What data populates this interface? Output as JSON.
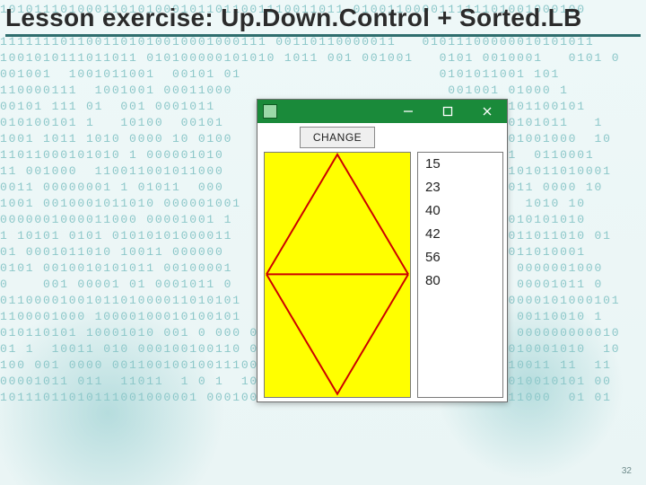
{
  "slide": {
    "title": "Lesson exercise: Up.Down.Control + Sorted.LB",
    "page_number": "32"
  },
  "window": {
    "change_button_label": "CHANGE",
    "listbox_items": [
      "15",
      "23",
      "40",
      "42",
      "56",
      "80"
    ]
  },
  "background": {
    "binary_lines": [
      "1010111010001101010001011011001110011011 010011000011111101001000100",
      "                                                                    ",
      "1111111011001101010010001000111 00110110000011   01011100000010101011",
      "1001010111011011 010100000101010 1011 001 001001   0101 0010001   0101 0",
      "001001  1001011001  00101 01                       0101011001 101     ",
      "110000111  1001001 00011000                         001001 01000 1    ",
      "00101 111 01  001 0001011                            0101 0101100101  ",
      "010100101 1   10100  00101                              1010101011   1",
      "1001 1011 1010 0000 10 0100                            01 001001000  10",
      "11011000101010 1 000001010                             01011  0110001 ",
      "11 001000  110011001011000                               00101011010001",
      "0011 00000001 1 01011  000                            1 001011 0000 10 ",
      "1001 0010001011010 000001001                          001 1  1010 10   ",
      "0000001000011000 00001001 1                           01010010101010  ",
      "1 10101 0101 01010101000011                             001011011010 01 ",
      "01 0001011010 10011 000000                           0101 0011010001  ",
      "0101 0010010101011 00100001                           01010 0000001000 ",
      "0    001 00001 01 0001011 0                           0101  00001011 0 ",
      "0110000100101101000011010101                           00000000101000101",
      "1100001000 10000100010100101                          01000 00110010 1  ",
      "010110101 10001010 001 0 000 00000 0000000 10010 0 01 10001 000000000010",
      "01 1  10011 010 000100100110 01010001001 01 1 0010 00100010010001010  10",
      "100 001 0000 001100100100111001 1  00010010010000 110000 0110011 11  11",
      "00001011 011  11011  1 0 1  10101 01  000 1 01001 01 1 0001010010101 00",
      "10111011010111001000001 000100011010011001 00011 1 01 0100011000  01 01"
    ]
  }
}
